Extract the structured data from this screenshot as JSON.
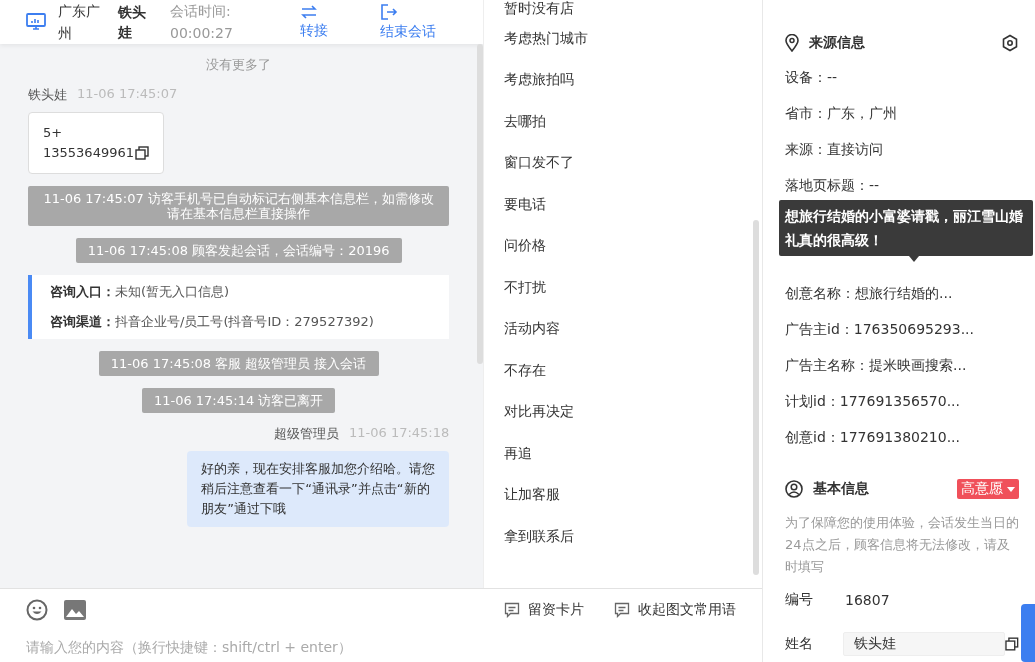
{
  "header": {
    "location": "广东广州",
    "visitor": "铁头娃",
    "duration_label": "会话时间:",
    "duration": "00:00:27",
    "actions": [
      {
        "kind": "transfer",
        "label": "转接"
      },
      {
        "kind": "end",
        "label": "结束会话"
      }
    ]
  },
  "chat": {
    "no_more": "没有更多了",
    "messages": [
      {
        "kind": "visitor",
        "name": "铁头娃",
        "time": "11-06 17:45:07",
        "card_lines": [
          "5+",
          "13553649961"
        ]
      },
      {
        "kind": "system",
        "text": "11-06 17:45:07 访客手机号已自动标记右侧基本信息栏，如需修改请在基本信息栏直接操作"
      },
      {
        "kind": "system",
        "text": "11-06 17:45:08 顾客发起会话，会话编号：20196"
      },
      {
        "kind": "entry",
        "rows": [
          {
            "label": "咨询入口：",
            "value": "未知(暂无入口信息)"
          },
          {
            "label": "咨询渠道：",
            "value": "抖音企业号/员工号(抖音号ID：279527392)"
          }
        ]
      },
      {
        "kind": "system",
        "text": "11-06 17:45:08 客服 超级管理员 接入会话"
      },
      {
        "kind": "system",
        "text": "11-06 17:45:14 访客已离开"
      },
      {
        "kind": "agent",
        "name": "超级管理员",
        "time": "11-06 17:45:18",
        "text": "好的亲，现在安排客服加您介绍哈。请您稍后注意查看一下“通讯录”并点击“新的朋友”通过下哦"
      }
    ]
  },
  "phrases": [
    "暂时没有店",
    "考虑热门城市",
    "考虑旅拍吗",
    "去哪拍",
    "窗口发不了",
    "要电话",
    "问价格",
    "不打扰",
    "活动内容",
    "不存在",
    "对比再决定",
    "再追",
    "让加客服",
    "拿到联系后"
  ],
  "composer": {
    "tools": [
      {
        "kind": "emoji"
      },
      {
        "kind": "image"
      }
    ],
    "actions": [
      "留资卡片",
      "收起图文常用语"
    ],
    "placeholder": "请输入您的内容（换行快捷键：shift/ctrl + enter）"
  },
  "source_info": {
    "title": "来源信息",
    "fields_before": [
      "设备：--",
      "省市：广东，广州",
      "来源：直接访问",
      "落地页标题：--"
    ],
    "tooltip": "想旅行结婚的小富婆请戳，丽江雪山婚礼真的很高级！",
    "fields_after": [
      "创意名称：想旅行结婚的...",
      "广告主id：176350695293...",
      "广告主名称：提米映画搜索...",
      "计划id：177691356570...",
      "创意id：177691380210..."
    ]
  },
  "basic_info": {
    "title": "基本信息",
    "intent_tag": "高意愿",
    "notice": "为了保障您的使用体验，会话发生当日的24点之后，顾客信息将无法修改，请及时填写",
    "fields": [
      {
        "kind": "text",
        "label": "编号",
        "value": "16807"
      },
      {
        "kind": "input",
        "label": "姓名",
        "value": "铁头娃"
      }
    ]
  }
}
